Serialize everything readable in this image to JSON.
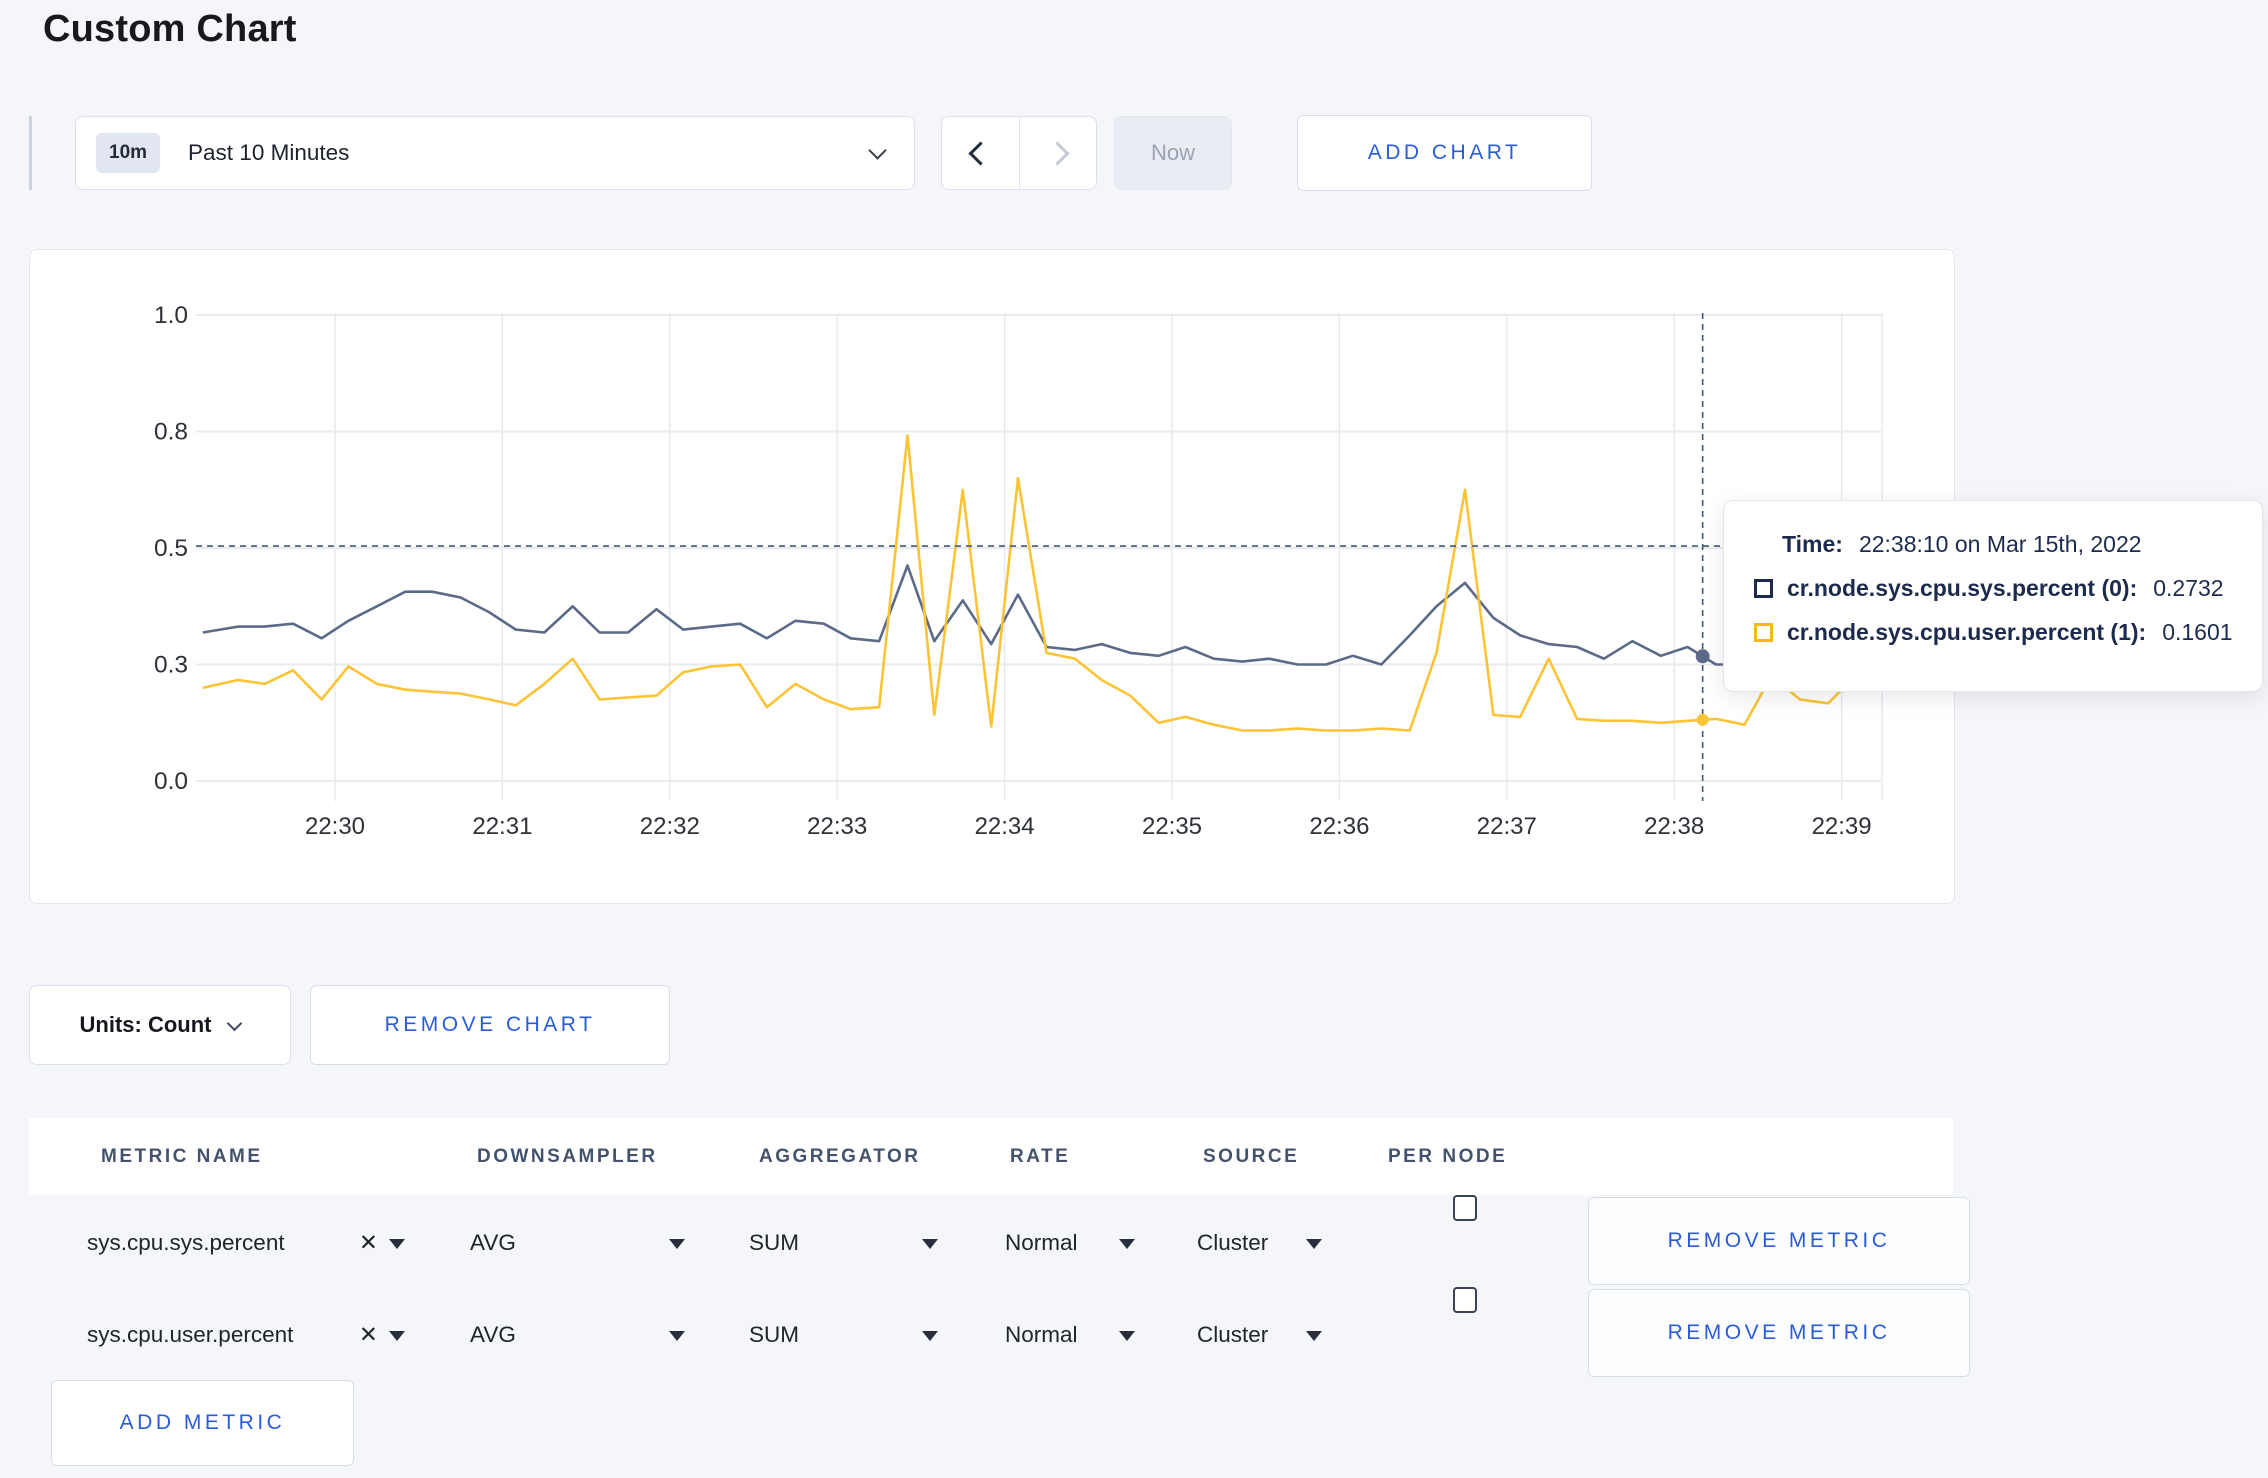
{
  "title": "Custom Chart",
  "toolbar": {
    "time_badge": "10m",
    "time_label": "Past 10 Minutes",
    "now_label": "Now",
    "add_chart_label": "ADD CHART"
  },
  "chart": {
    "units_label": "Units: Count",
    "remove_chart_label": "REMOVE CHART"
  },
  "tooltip": {
    "time_label": "Time:",
    "time_value": "22:38:10 on Mar 15th, 2022",
    "rows": [
      {
        "label": "cr.node.sys.cpu.sys.percent (0):",
        "value": "0.2732",
        "color": "#1c2b4d"
      },
      {
        "label": "cr.node.sys.cpu.user.percent (1):",
        "value": "0.1601",
        "color": "#f5b916"
      }
    ]
  },
  "chart_data": {
    "type": "line",
    "title": "",
    "xlabel": "",
    "ylabel": "",
    "grid": true,
    "legend_position": "tooltip",
    "y_ticks": {
      "labels": [
        "1.0",
        "0.8",
        "0.5",
        "0.3",
        "0.0"
      ],
      "values": [
        1.0,
        0.8,
        0.5,
        0.3,
        0.0
      ]
    },
    "x_ticks": [
      "22:30",
      "22:31",
      "22:32",
      "22:33",
      "22:34",
      "22:35",
      "22:36",
      "22:37",
      "22:38",
      "22:39"
    ],
    "x_unit": "minutes offset from 22:30",
    "xlim": [
      -0.79,
      9.15
    ],
    "ylim": [
      0,
      1
    ],
    "crosshair": {
      "t": 8.17,
      "hline_value": 0.505,
      "time": "22:38:10"
    },
    "series": [
      {
        "name": "cr.node.sys.cpu.sys.percent (0)",
        "color": "#5b6a87",
        "points": [
          [
            -0.79,
            0.355
          ],
          [
            -0.58,
            0.365
          ],
          [
            -0.42,
            0.365
          ],
          [
            -0.25,
            0.37
          ],
          [
            -0.08,
            0.345
          ],
          [
            0.08,
            0.375
          ],
          [
            0.25,
            0.4
          ],
          [
            0.42,
            0.425
          ],
          [
            0.58,
            0.425
          ],
          [
            0.75,
            0.415
          ],
          [
            0.92,
            0.39
          ],
          [
            1.08,
            0.36
          ],
          [
            1.25,
            0.355
          ],
          [
            1.42,
            0.4
          ],
          [
            1.58,
            0.355
          ],
          [
            1.75,
            0.355
          ],
          [
            1.92,
            0.395
          ],
          [
            2.08,
            0.36
          ],
          [
            2.25,
            0.365
          ],
          [
            2.42,
            0.37
          ],
          [
            2.58,
            0.345
          ],
          [
            2.75,
            0.375
          ],
          [
            2.92,
            0.37
          ],
          [
            3.08,
            0.345
          ],
          [
            3.25,
            0.34
          ],
          [
            3.42,
            0.47
          ],
          [
            3.58,
            0.34
          ],
          [
            3.75,
            0.41
          ],
          [
            3.92,
            0.335
          ],
          [
            4.08,
            0.42
          ],
          [
            4.25,
            0.33
          ],
          [
            4.42,
            0.325
          ],
          [
            4.58,
            0.335
          ],
          [
            4.75,
            0.32
          ],
          [
            4.92,
            0.315
          ],
          [
            5.08,
            0.33
          ],
          [
            5.25,
            0.31
          ],
          [
            5.42,
            0.305
          ],
          [
            5.58,
            0.31
          ],
          [
            5.75,
            0.3
          ],
          [
            5.92,
            0.3
          ],
          [
            6.08,
            0.315
          ],
          [
            6.25,
            0.3
          ],
          [
            6.42,
            0.35
          ],
          [
            6.58,
            0.4
          ],
          [
            6.75,
            0.44
          ],
          [
            6.92,
            0.38
          ],
          [
            7.08,
            0.35
          ],
          [
            7.25,
            0.335
          ],
          [
            7.42,
            0.33
          ],
          [
            7.58,
            0.31
          ],
          [
            7.75,
            0.34
          ],
          [
            7.92,
            0.315
          ],
          [
            8.08,
            0.33
          ],
          [
            8.25,
            0.3
          ],
          [
            8.42,
            0.3
          ],
          [
            8.58,
            0.31
          ],
          [
            8.75,
            0.305
          ],
          [
            8.92,
            0.3
          ],
          [
            9.08,
            0.31
          ],
          [
            9.15,
            0.305
          ]
        ]
      },
      {
        "name": "cr.node.sys.cpu.user.percent (1)",
        "color": "#fbc437",
        "points": [
          [
            -0.79,
            0.24
          ],
          [
            -0.58,
            0.26
          ],
          [
            -0.42,
            0.25
          ],
          [
            -0.25,
            0.285
          ],
          [
            -0.08,
            0.21
          ],
          [
            0.08,
            0.295
          ],
          [
            0.25,
            0.25
          ],
          [
            0.42,
            0.235
          ],
          [
            0.58,
            0.23
          ],
          [
            0.75,
            0.225
          ],
          [
            0.92,
            0.21
          ],
          [
            1.08,
            0.195
          ],
          [
            1.25,
            0.25
          ],
          [
            1.42,
            0.31
          ],
          [
            1.58,
            0.21
          ],
          [
            1.75,
            0.215
          ],
          [
            1.92,
            0.22
          ],
          [
            2.08,
            0.28
          ],
          [
            2.25,
            0.295
          ],
          [
            2.42,
            0.3
          ],
          [
            2.58,
            0.19
          ],
          [
            2.75,
            0.25
          ],
          [
            2.92,
            0.21
          ],
          [
            3.08,
            0.185
          ],
          [
            3.25,
            0.19
          ],
          [
            3.42,
            0.79
          ],
          [
            3.58,
            0.17
          ],
          [
            3.75,
            0.65
          ],
          [
            3.92,
            0.14
          ],
          [
            4.08,
            0.68
          ],
          [
            4.25,
            0.32
          ],
          [
            4.42,
            0.31
          ],
          [
            4.58,
            0.26
          ],
          [
            4.75,
            0.22
          ],
          [
            4.92,
            0.15
          ],
          [
            5.08,
            0.165
          ],
          [
            5.25,
            0.145
          ],
          [
            5.42,
            0.13
          ],
          [
            5.58,
            0.13
          ],
          [
            5.75,
            0.135
          ],
          [
            5.92,
            0.13
          ],
          [
            6.08,
            0.13
          ],
          [
            6.25,
            0.135
          ],
          [
            6.42,
            0.13
          ],
          [
            6.58,
            0.32
          ],
          [
            6.75,
            0.65
          ],
          [
            6.92,
            0.17
          ],
          [
            7.08,
            0.165
          ],
          [
            7.25,
            0.31
          ],
          [
            7.42,
            0.16
          ],
          [
            7.58,
            0.155
          ],
          [
            7.75,
            0.155
          ],
          [
            7.92,
            0.15
          ],
          [
            8.08,
            0.155
          ],
          [
            8.25,
            0.16
          ],
          [
            8.42,
            0.145
          ],
          [
            8.58,
            0.27
          ],
          [
            8.75,
            0.21
          ],
          [
            8.92,
            0.2
          ],
          [
            9.08,
            0.27
          ],
          [
            9.15,
            0.235
          ]
        ]
      }
    ]
  },
  "metrics": {
    "headers": [
      "METRIC NAME",
      "DOWNSAMPLER",
      "AGGREGATOR",
      "RATE",
      "SOURCE",
      "PER NODE"
    ],
    "rows": [
      {
        "name": "sys.cpu.sys.percent",
        "downsampler": "AVG",
        "aggregator": "SUM",
        "rate": "Normal",
        "source": "Cluster",
        "per_node_checked": false,
        "remove_label": "REMOVE METRIC"
      },
      {
        "name": "sys.cpu.user.percent",
        "downsampler": "AVG",
        "aggregator": "SUM",
        "rate": "Normal",
        "source": "Cluster",
        "per_node_checked": false,
        "remove_label": "REMOVE METRIC"
      }
    ],
    "add_metric_label": "ADD METRIC"
  },
  "colors": {
    "accent_blue": "#2a5cda",
    "series_sys": "#5b6a87",
    "series_user": "#fbc437",
    "crosshair": "#3e5878",
    "gridline": "#e8eaee",
    "tooltip_text": "#1c2b4d",
    "page_background": "#f5f6f9"
  }
}
